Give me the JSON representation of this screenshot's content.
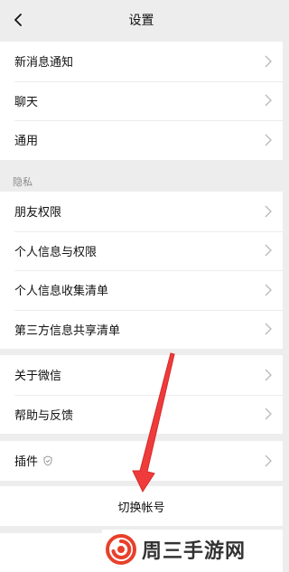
{
  "header": {
    "title": "设置",
    "back_icon": "chevron-left-icon"
  },
  "group1": {
    "items": [
      {
        "label": "新消息通知"
      },
      {
        "label": "聊天"
      },
      {
        "label": "通用"
      }
    ]
  },
  "privacy": {
    "section_label": "隐私",
    "items": [
      {
        "label": "朋友权限"
      },
      {
        "label": "个人信息与权限"
      },
      {
        "label": "个人信息收集清单"
      },
      {
        "label": "第三方信息共享清单"
      }
    ]
  },
  "group3": {
    "items": [
      {
        "label": "关于微信"
      },
      {
        "label": "帮助与反馈"
      }
    ]
  },
  "plugins": {
    "label": "插件",
    "badge_icon": "shield-icon"
  },
  "switch_account": {
    "label": "切换帐号"
  },
  "annotation": {
    "arrow_color": "#ef3b3b",
    "icon": "red-arrow-icon"
  },
  "watermark": {
    "text": "周三手游网",
    "logo_color": "#e8402a"
  }
}
